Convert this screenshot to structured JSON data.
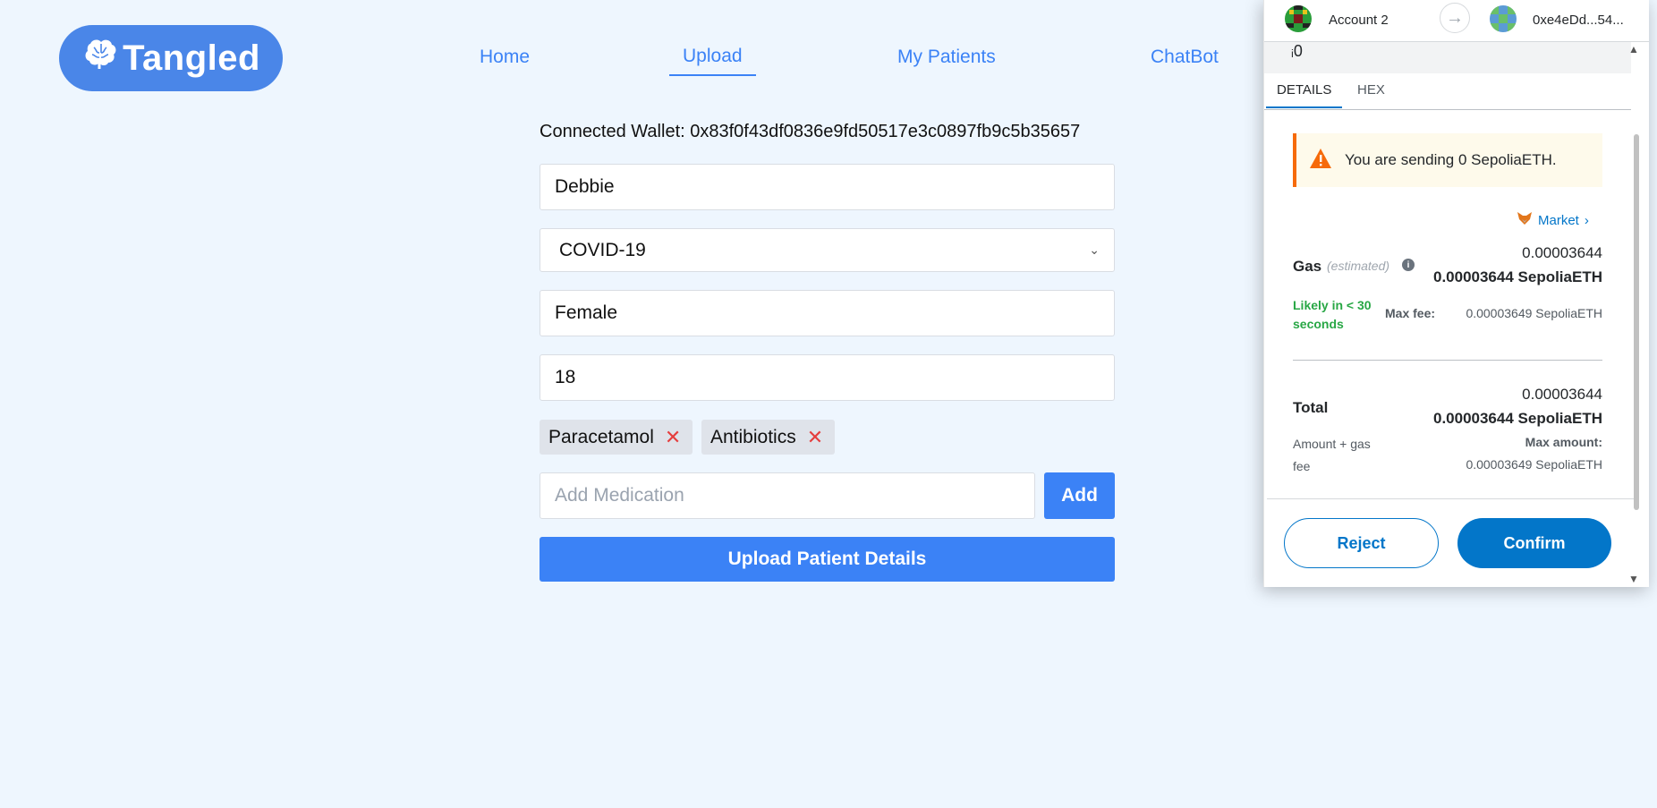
{
  "brand": {
    "name": "Tangled",
    "icon": "brain-icon"
  },
  "nav": {
    "home": "Home",
    "upload": "Upload",
    "patients": "My Patients",
    "chatbot": "ChatBot"
  },
  "form": {
    "wallet_text": "Connected Wallet: 0x83f0f43df0836e9fd50517e3c0897fb9c5b35657",
    "name_value": "Debbie",
    "disease_value": "COVID-19",
    "gender_value": "Female",
    "age_value": "18",
    "medications": [
      "Paracetamol",
      "Antibiotics"
    ],
    "medication_placeholder": "Add Medication",
    "add_label": "Add",
    "upload_label": "Upload Patient Details"
  },
  "metamask": {
    "account_name": "Account 2",
    "recipient": "0xe4eDd...54...",
    "tabs": {
      "details": "DETAILS",
      "hex": "HEX"
    },
    "warning": "You are sending 0 SepoliaETH.",
    "market_label": "Market",
    "gas_label": "Gas",
    "gas_estimated": "(estimated)",
    "gas_value": "0.00003644",
    "gas_value_eth": "0.00003644 SepoliaETH",
    "likely_text": "Likely in < 30 seconds",
    "max_fee_label": "Max fee:",
    "max_fee_value": "0.00003649 SepoliaETH",
    "total_label": "Total",
    "total_value": "0.00003644",
    "total_value_eth": "0.00003644 SepoliaETH",
    "amount_gas_fee": "Amount + gas fee",
    "max_amount_label": "Max amount:",
    "max_amount_value": "0.00003649 SepoliaETH",
    "reject_label": "Reject",
    "confirm_label": "Confirm",
    "colors": {
      "primary": "#0376c9",
      "warning": "#f66a0a",
      "success": "#28a745"
    }
  },
  "colors": {
    "accent": "#3b82f6",
    "background": "#eef6fe",
    "logo": "#4a86e8"
  }
}
